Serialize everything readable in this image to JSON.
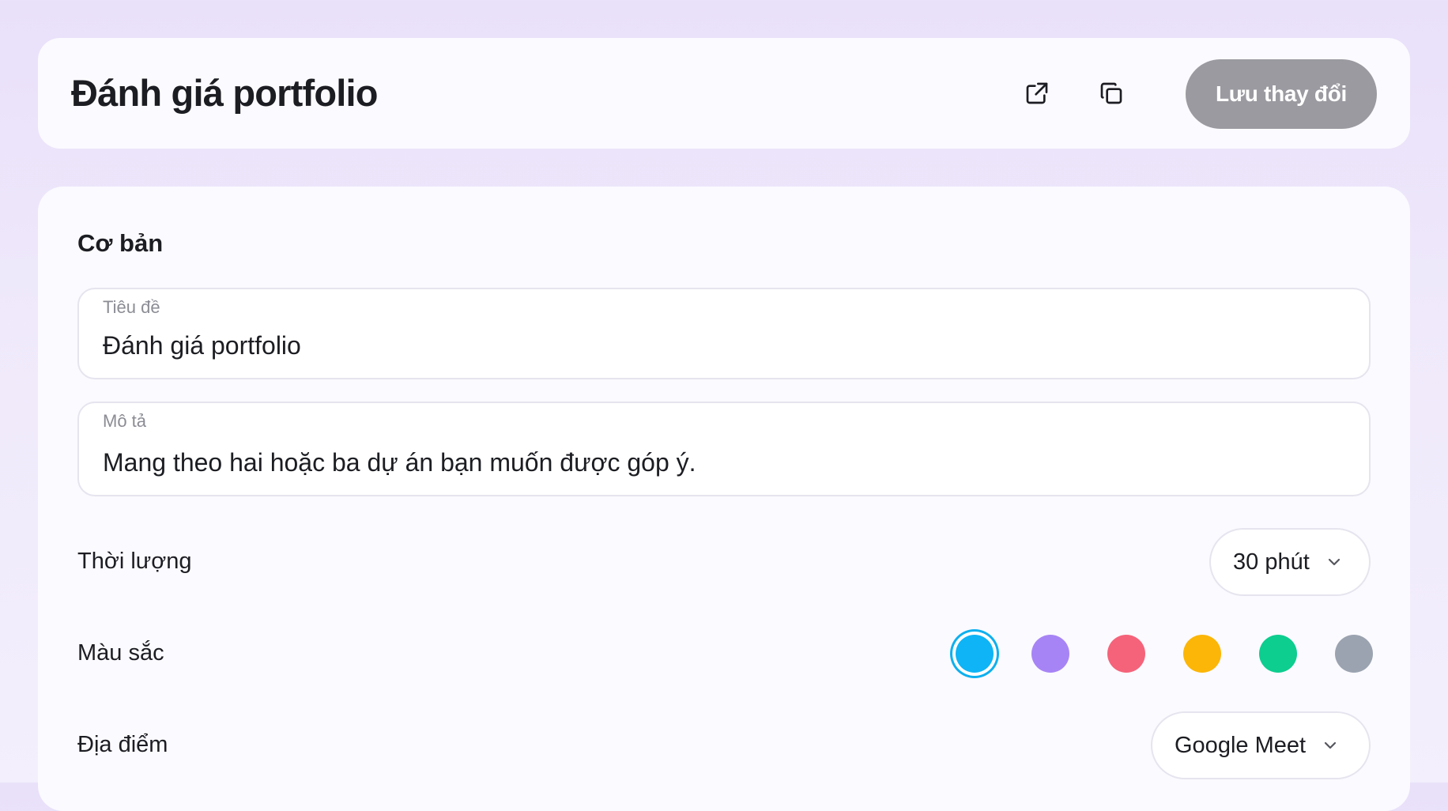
{
  "header": {
    "title": "Đánh giá portfolio",
    "icons": [
      "external-link-icon",
      "copy-icon"
    ],
    "save_label": "Lưu thay đổi",
    "save_button_color": "#9a9aa0"
  },
  "basic": {
    "section_title": "Cơ bản",
    "title_field": {
      "label": "Tiêu đề",
      "value": "Đánh giá portfolio"
    },
    "description_field": {
      "label": "Mô tả",
      "value": "Mang theo hai hoặc ba dự án bạn muốn được góp ý."
    },
    "duration": {
      "label": "Thời lượng",
      "value": "30 phút"
    },
    "color": {
      "label": "Màu sắc",
      "options": [
        "#0eb4f5",
        "#a784f5",
        "#f5637a",
        "#fbb608",
        "#0dcd8f",
        "#9ba3b0"
      ],
      "selected_index": 0
    },
    "location": {
      "label": "Địa điểm",
      "value": "Google Meet"
    }
  }
}
